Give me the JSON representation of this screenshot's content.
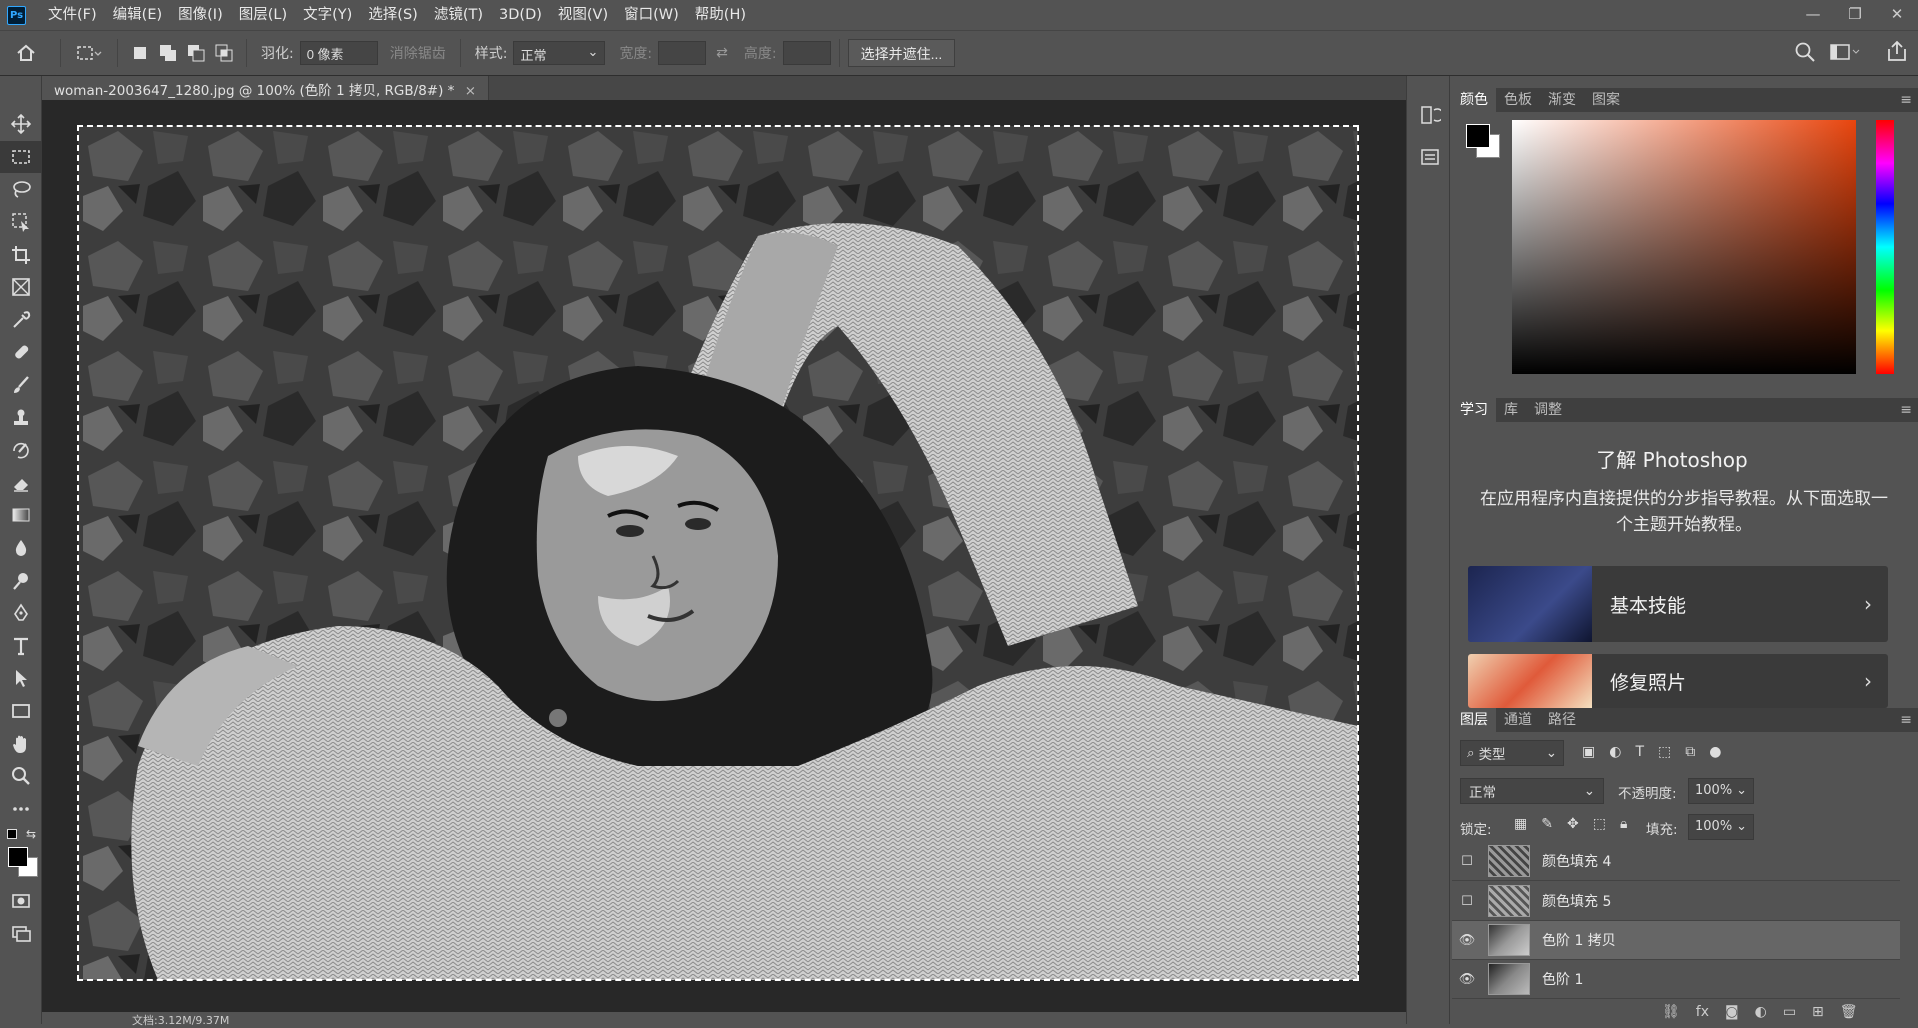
{
  "app": {
    "logo": "Ps"
  },
  "menu": [
    "文件(F)",
    "编辑(E)",
    "图像(I)",
    "图层(L)",
    "文字(Y)",
    "选择(S)",
    "滤镜(T)",
    "3D(D)",
    "视图(V)",
    "窗口(W)",
    "帮助(H)"
  ],
  "window_controls": [
    "—",
    "❐",
    "✕"
  ],
  "options": {
    "feather_label": "羽化:",
    "feather_value": "0 像素",
    "antialias_label": "消除锯齿",
    "style_label": "样式:",
    "style_value": "正常",
    "width_label": "宽度:",
    "height_label": "高度:",
    "select_mask_button": "选择并遮住..."
  },
  "document": {
    "tab_title": "woman-2003647_1280.jpg @ 100% (色阶 1 拷贝, RGB/8#) *",
    "status": "文档:3.12M/9.37M"
  },
  "color_panel": {
    "tabs": [
      "颜色",
      "色板",
      "渐变",
      "图案"
    ],
    "foreground": "#000000",
    "background": "#ffffff",
    "hue_color": "#e8450e"
  },
  "learn_panel": {
    "tabs": [
      "学习",
      "库",
      "调整"
    ],
    "title": "了解 Photoshop",
    "description": "在应用程序内直接提供的分步指导教程。从下面选取一个主题开始教程。",
    "cards": [
      {
        "label": "基本技能"
      },
      {
        "label": "修复照片"
      }
    ]
  },
  "layers_panel": {
    "tabs": [
      "图层",
      "通道",
      "路径"
    ],
    "filter_label": "类型",
    "blend_mode": "正常",
    "opacity_label": "不透明度:",
    "opacity_value": "100%",
    "lock_label": "锁定:",
    "fill_label": "填充:",
    "fill_value": "100%",
    "layers": [
      {
        "name": "颜色填充 4",
        "visible": false,
        "selected": false
      },
      {
        "name": "颜色填充 5",
        "visible": false,
        "selected": false
      },
      {
        "name": "色阶 1 拷贝",
        "visible": true,
        "selected": true
      },
      {
        "name": "色阶 1",
        "visible": true,
        "selected": false
      }
    ]
  }
}
